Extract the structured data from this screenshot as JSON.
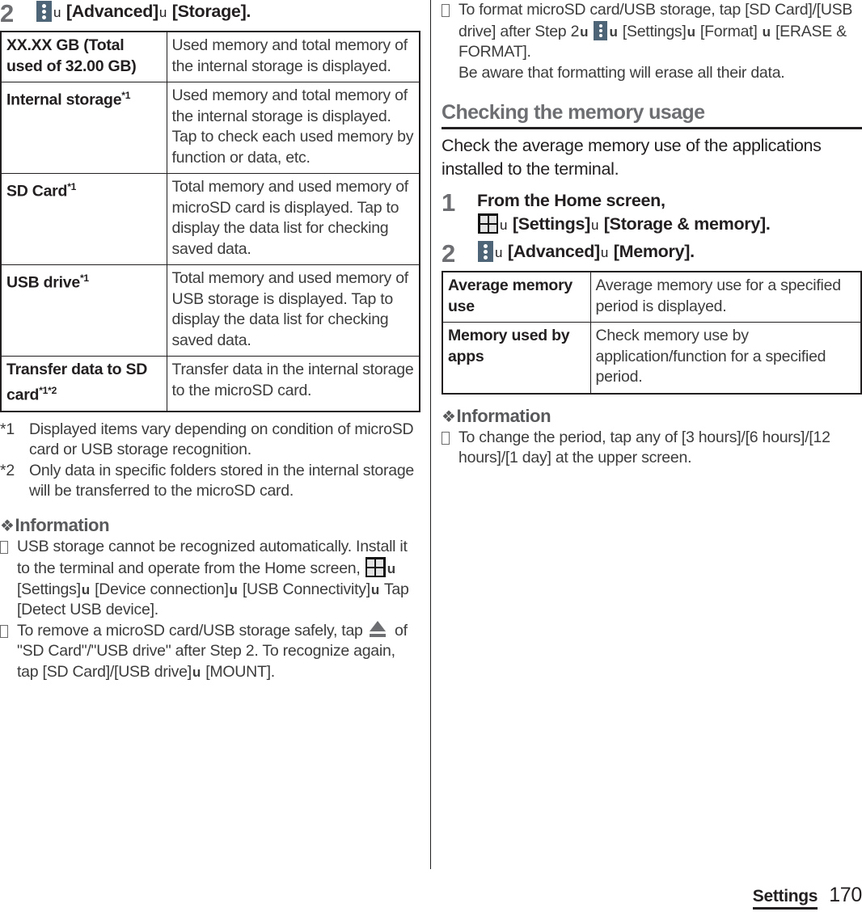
{
  "page": {
    "footer_section": "Settings",
    "page_number": "170",
    "arrow_glyph": "u",
    "bullet_glyph": "⎕"
  },
  "colors": {
    "kebab_icon_bg": "#4d6576",
    "step_number": "#6d6e71",
    "section_heading": "#6d6e71",
    "information_heading": "#58595b",
    "body_text": "#3c3c3c",
    "rule": "#231f20"
  },
  "left_column": {
    "step": {
      "number": "2",
      "icon": "kebab-menu-icon",
      "parts": [
        {
          "type": "icon",
          "name": "kebab-menu-icon"
        },
        {
          "type": "arrow",
          "text": "u"
        },
        {
          "type": "bold",
          "text": "[Advanced]"
        },
        {
          "type": "arrow",
          "text": "u"
        },
        {
          "type": "bold",
          "text": "[Storage]."
        }
      ],
      "plain": "☰ u [Advanced]u [Storage]."
    },
    "table": {
      "rows": [
        {
          "key": "XX.XX GB (Total used of 32.00 GB)",
          "key_sup": "",
          "value": "Used memory and total memory of the internal storage is displayed."
        },
        {
          "key": "Internal storage",
          "key_sup": "*1",
          "value": "Used memory and total memory of the internal storage is displayed. Tap to check each used memory by function or data, etc."
        },
        {
          "key": "SD Card",
          "key_sup": "*1",
          "value": "Total memory and used memory of microSD card is displayed. Tap to display the data list for checking saved data."
        },
        {
          "key": "USB drive",
          "key_sup": "*1",
          "value": "Total memory and used memory of USB storage is displayed. Tap to display the data list for checking saved data."
        },
        {
          "key": "Transfer data to SD card",
          "key_sup": "*1*2",
          "value": "Transfer data in the internal storage to the microSD card."
        }
      ]
    },
    "footnotes": [
      {
        "mark": "*1",
        "text": "Displayed items vary depending on condition of microSD card or USB storage recognition."
      },
      {
        "mark": "*2",
        "text": "Only data in specific folders stored in the internal storage will be transferred to the microSD card."
      }
    ],
    "information": {
      "heading": "Information",
      "bullets": [
        {
          "segments": [
            {
              "type": "text",
              "text": "USB storage cannot be recognized automatically. Install it to the terminal and operate from the Home screen, "
            },
            {
              "type": "icon",
              "name": "apps-grid-icon"
            },
            {
              "type": "arrow",
              "text": "u"
            },
            {
              "type": "text",
              "text": " [Settings]"
            },
            {
              "type": "arrow",
              "text": "u"
            },
            {
              "type": "text",
              "text": " [Device connection]"
            },
            {
              "type": "arrow",
              "text": "u"
            },
            {
              "type": "text",
              "text": " [USB Connectivity]"
            },
            {
              "type": "arrow",
              "text": "u"
            },
            {
              "type": "text",
              "text": " Tap [Detect USB device]."
            }
          ]
        },
        {
          "segments": [
            {
              "type": "text",
              "text": "To remove a microSD card/USB storage safely, tap "
            },
            {
              "type": "icon",
              "name": "eject-icon"
            },
            {
              "type": "text",
              "text": " of \"SD Card\"/\"USB drive\" after Step 2. To recognize again, tap [SD Card]/[USB drive]"
            },
            {
              "type": "arrow",
              "text": "u"
            },
            {
              "type": "text",
              "text": " [MOUNT]."
            }
          ]
        }
      ]
    }
  },
  "right_column": {
    "top_bullet": {
      "segments": [
        {
          "type": "text",
          "text": "To format microSD card/USB storage, tap [SD Card]/[USB drive] after Step 2"
        },
        {
          "type": "arrow",
          "text": "u"
        },
        {
          "type": "icon",
          "name": "kebab-menu-icon"
        },
        {
          "type": "arrow",
          "text": "u"
        },
        {
          "type": "text",
          "text": " [Settings]"
        },
        {
          "type": "arrow",
          "text": "u"
        },
        {
          "type": "text",
          "text": " [Format] "
        },
        {
          "type": "arrow",
          "text": "u"
        },
        {
          "type": "text",
          "text": " [ERASE & FORMAT]."
        }
      ],
      "second_line": "Be aware that formatting will erase all their data."
    },
    "section_heading": "Checking the memory usage",
    "lead": "Check the average memory use of the applications installed to the terminal.",
    "steps": [
      {
        "number": "1",
        "parts": [
          {
            "type": "bold",
            "text": "From the Home screen,"
          },
          {
            "type": "break"
          },
          {
            "type": "icon",
            "name": "apps-grid-icon"
          },
          {
            "type": "arrow",
            "text": "u"
          },
          {
            "type": "bold",
            "text": " [Settings]"
          },
          {
            "type": "arrow",
            "text": "u"
          },
          {
            "type": "bold",
            "text": " [Storage & memory]."
          }
        ],
        "plain": "From the Home screen, ░u [Settings]u [Storage & memory]."
      },
      {
        "number": "2",
        "parts": [
          {
            "type": "icon",
            "name": "kebab-menu-icon"
          },
          {
            "type": "arrow",
            "text": "u"
          },
          {
            "type": "bold",
            "text": " [Advanced]"
          },
          {
            "type": "arrow",
            "text": "u"
          },
          {
            "type": "bold",
            "text": " [Memory]."
          }
        ],
        "plain": "☰u [Advanced]u [Memory]."
      }
    ],
    "table": {
      "rows": [
        {
          "key": "Average memory use",
          "value": "Average memory use for a specified period is displayed."
        },
        {
          "key": "Memory used by apps",
          "value": "Check memory use by application/function for a specified period."
        }
      ]
    },
    "information": {
      "heading": "Information",
      "bullets": [
        {
          "segments": [
            {
              "type": "text",
              "text": "To change the period, tap any of [3 hours]/[6 hours]/[12 hours]/[1 day] at the upper screen."
            }
          ]
        }
      ]
    }
  }
}
